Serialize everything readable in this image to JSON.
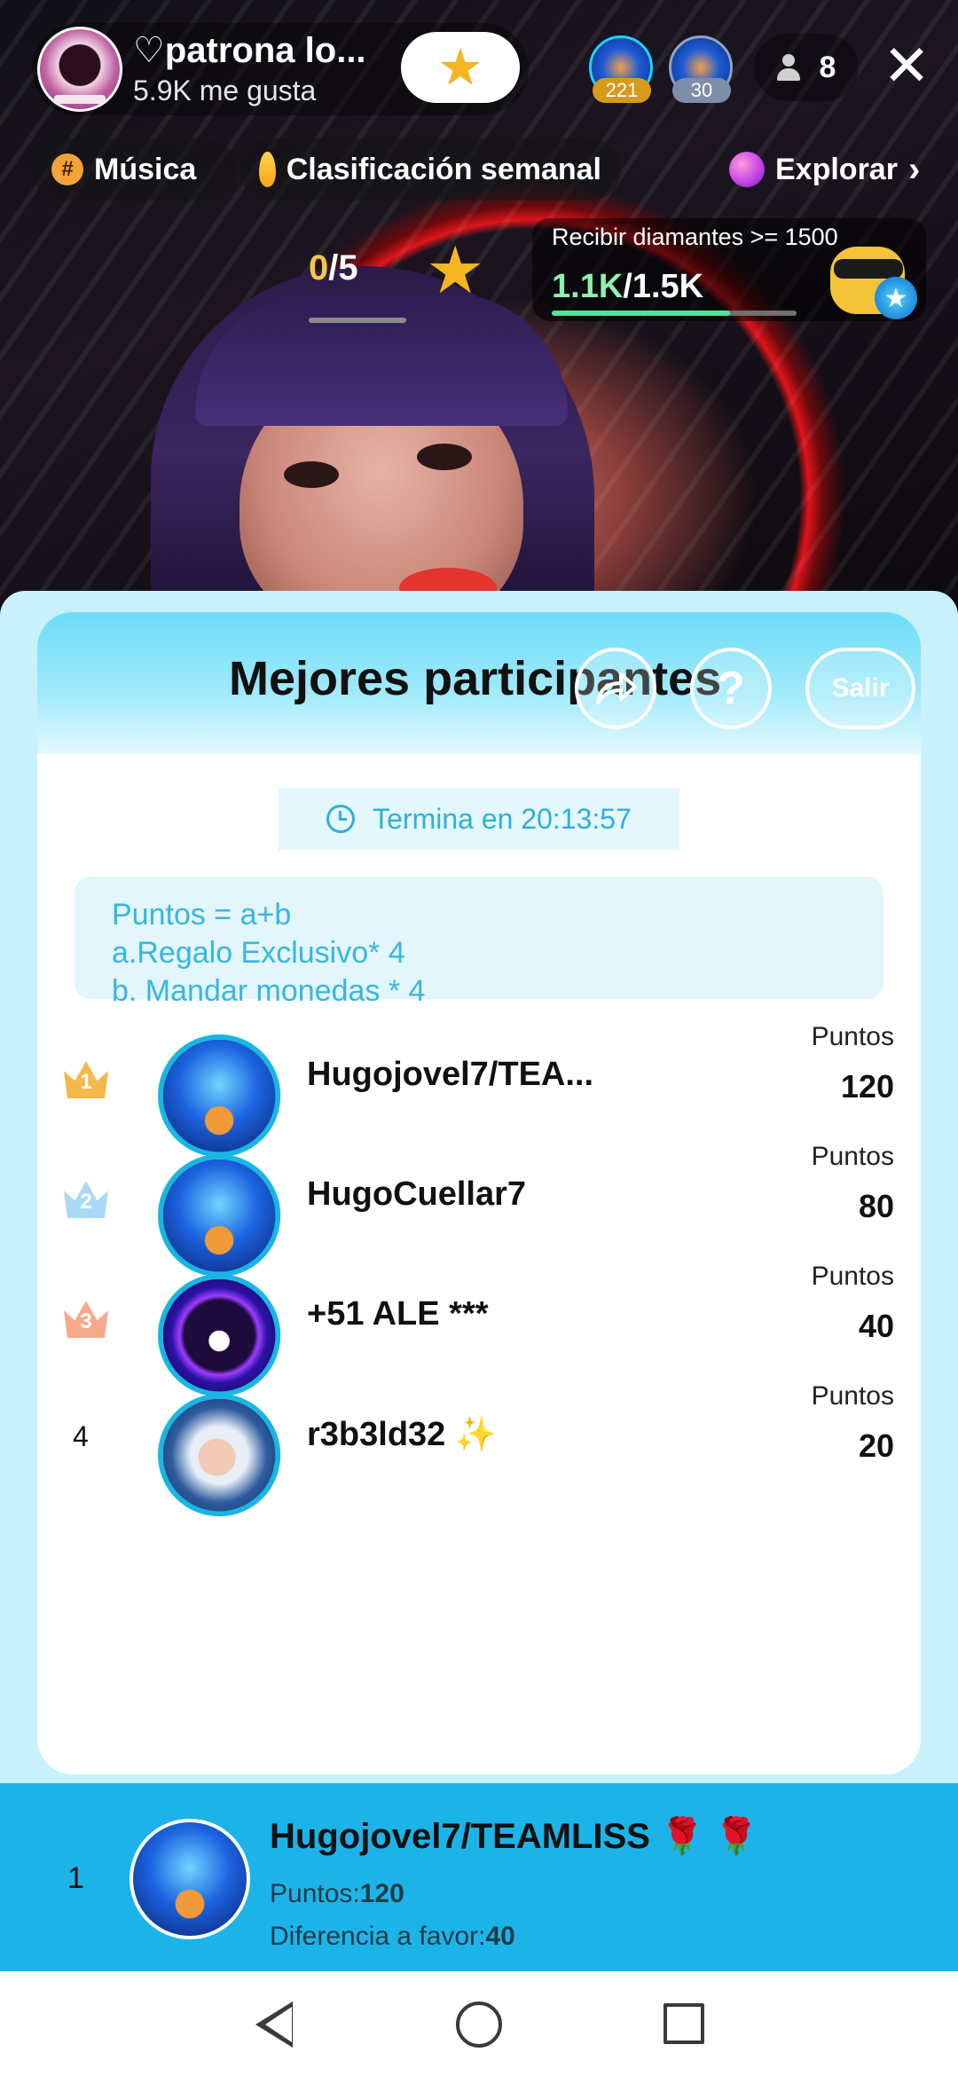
{
  "host": {
    "name": "♡patrona lo...",
    "likes": "5.9K me gusta"
  },
  "top_viewers": [
    {
      "badge": "221"
    },
    {
      "badge": "30"
    }
  ],
  "viewer_count": "8",
  "icons": {
    "follow": "star-icon",
    "close": "close-icon",
    "viewers": "person-icon",
    "music": "hashtag-icon",
    "ranking": "flame-icon",
    "explore": "planet-icon",
    "share": "share-icon",
    "help": "question-icon",
    "timer": "clock-icon"
  },
  "chips": {
    "music": "Música",
    "ranking": "Clasificación semanal",
    "explore": "Explorar"
  },
  "goal": {
    "current": "0",
    "total": "/5",
    "diamond_title": "Recibir diamantes >= 1500",
    "diamond_current": "1.1K",
    "diamond_total": "/1.5K",
    "diamond_progress_fraction": 0.73
  },
  "leaderboard": {
    "title": "Mejores participantes",
    "exit_label": "Salir",
    "help_label": "?",
    "timer_label": "Termina en 20:13:57",
    "rules": [
      "Puntos = a+b",
      "a.Regalo Exclusivo* 4",
      "b. Mandar monedas * 4"
    ],
    "points_label": "Puntos",
    "entries": [
      {
        "rank": "1",
        "name": "Hugojovel7/TEA...",
        "points": "120"
      },
      {
        "rank": "2",
        "name": "HugoCuellar7",
        "points": "80"
      },
      {
        "rank": "3",
        "name": "+51 ALE ***",
        "points": "40"
      },
      {
        "rank": "4",
        "name": "r3b3ld32 ✨",
        "points": "20"
      }
    ]
  },
  "me": {
    "rank": "1",
    "name": "Hugojovel7/TEAMLISS 🌹 🌹",
    "points_prefix": "Puntos:",
    "points": "120",
    "diff_prefix": "Diferencia a favor:",
    "diff": "40"
  },
  "colors": {
    "accent": "#1cb4e8",
    "sheet": "#c8f1fb",
    "gold": "#f6c54a",
    "crown_1": "#f5b84a",
    "crown_2": "#a9daf7",
    "crown_3": "#f7a98c"
  }
}
